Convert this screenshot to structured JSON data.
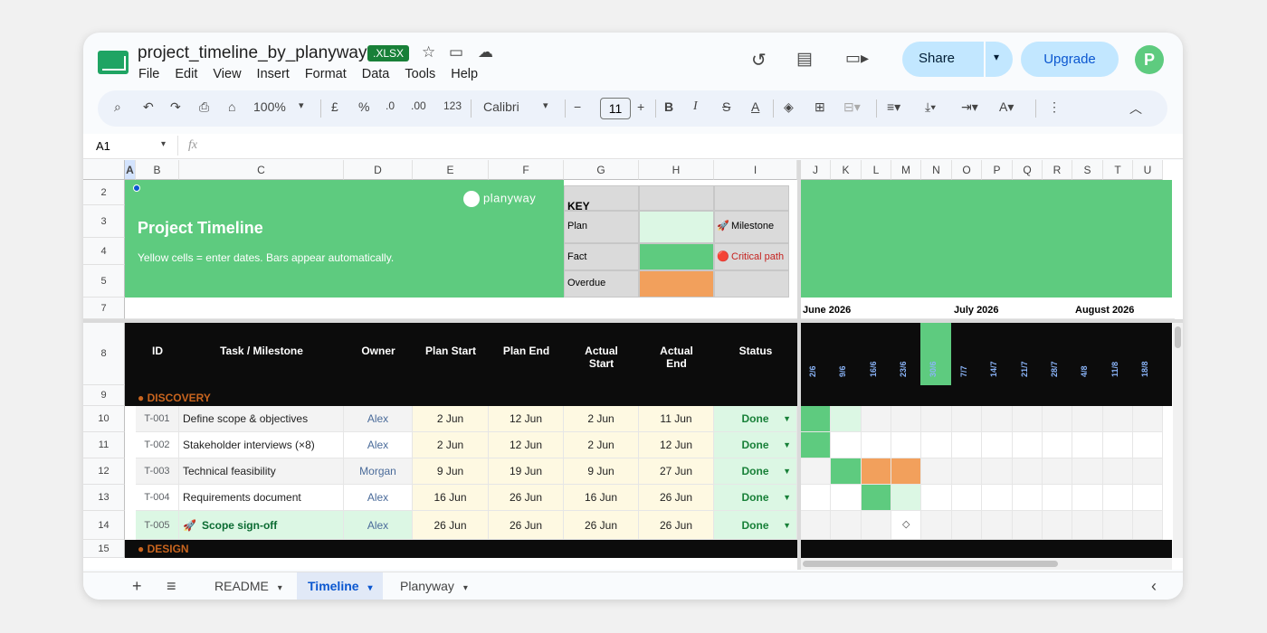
{
  "doc": {
    "title": "project_timeline_by_planyway",
    "badge": ".XLSX"
  },
  "menu": [
    "File",
    "Edit",
    "View",
    "Insert",
    "Format",
    "Data",
    "Tools",
    "Help"
  ],
  "header_buttons": {
    "share": "Share",
    "upgrade": "Upgrade",
    "planyway_logo": "P"
  },
  "toolbar": {
    "zoom": "100%",
    "currency": "£",
    "percent": "%",
    "dec_decrease": ".0",
    "dec_increase": ".00",
    "number_format": "123",
    "font": "Calibri",
    "font_size": "11",
    "bold": "B",
    "italic": "I",
    "strike": "S",
    "text_color": "A"
  },
  "formula_bar": {
    "cell_ref": "A1",
    "fx": "fx",
    "value": ""
  },
  "columns": [
    "A",
    "B",
    "C",
    "D",
    "E",
    "F",
    "G",
    "H",
    "I",
    "J",
    "K",
    "L",
    "M",
    "N",
    "O",
    "P",
    "Q",
    "R",
    "S",
    "T",
    "U"
  ],
  "row_numbers": [
    "2",
    "3",
    "4",
    "5",
    "7",
    "8",
    "9",
    "10",
    "11",
    "12",
    "13",
    "14",
    "15"
  ],
  "banner": {
    "brand": "planyway",
    "title": "Project Timeline",
    "subtitle": "Yellow cells = enter dates. Bars appear automatically."
  },
  "key": {
    "title": "KEY",
    "plan": "Plan",
    "fact": "Fact",
    "overdue": "Overdue",
    "milestone": "Milestone",
    "critical": "Critical path",
    "milestone_icon": "🚀",
    "critical_icon": "🔴"
  },
  "colors": {
    "green": "#5ecb7f",
    "light_green": "#dcf7e4",
    "orange": "#f2a05c",
    "yellow": "#fef9e2",
    "accent_blue": "#0b57d0",
    "section_orange": "#c8641e"
  },
  "months": [
    "June 2026",
    "July 2026",
    "August 2026"
  ],
  "week_labels": [
    "2/6",
    "9/6",
    "16/6",
    "23/6",
    "30/6",
    "7/7",
    "14/7",
    "21/7",
    "28/7",
    "4/8",
    "11/8",
    "18/8"
  ],
  "table_headers": {
    "id": "ID",
    "task": "Task / Milestone",
    "owner": "Owner",
    "plan_start": "Plan Start",
    "plan_end": "Plan End",
    "actual_start": "Actual Start",
    "actual_end": "Actual End",
    "status": "Status"
  },
  "sections": {
    "discovery": "● DISCOVERY",
    "design": "● DESIGN"
  },
  "tasks": [
    {
      "id": "T-001",
      "task": "Define scope & objectives",
      "owner": "Alex",
      "plan_start": "2 Jun",
      "plan_end": "12 Jun",
      "actual_start": "2 Jun",
      "actual_end": "11 Jun",
      "status": "Done"
    },
    {
      "id": "T-002",
      "task": "Stakeholder interviews (×8)",
      "owner": "Alex",
      "plan_start": "2 Jun",
      "plan_end": "12 Jun",
      "actual_start": "2 Jun",
      "actual_end": "12 Jun",
      "status": "Done"
    },
    {
      "id": "T-003",
      "task": "Technical feasibility",
      "owner": "Morgan",
      "plan_start": "9 Jun",
      "plan_end": "19 Jun",
      "actual_start": "9 Jun",
      "actual_end": "27 Jun",
      "status": "Done"
    },
    {
      "id": "T-004",
      "task": "Requirements document",
      "owner": "Alex",
      "plan_start": "16 Jun",
      "plan_end": "26 Jun",
      "actual_start": "16 Jun",
      "actual_end": "26 Jun",
      "status": "Done"
    },
    {
      "id": "T-005",
      "task": "Scope sign-off",
      "task_icon": "🚀",
      "owner": "Alex",
      "plan_start": "26 Jun",
      "plan_end": "26 Jun",
      "actual_start": "26 Jun",
      "actual_end": "26 Jun",
      "status": "Done"
    }
  ],
  "milestone_marker": "◇",
  "sheets": [
    {
      "name": "README"
    },
    {
      "name": "Timeline",
      "active": true
    },
    {
      "name": "Planyway"
    }
  ],
  "sheet_icons": {
    "add": "+",
    "list": "≡",
    "collapse": "‹"
  }
}
